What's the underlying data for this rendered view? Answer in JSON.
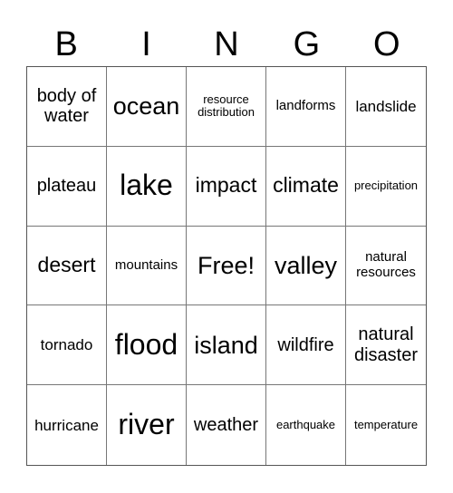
{
  "header": [
    "B",
    "I",
    "N",
    "G",
    "O"
  ],
  "cells": [
    [
      "body of water",
      "ocean",
      "resource distribution",
      "landforms",
      "landslide"
    ],
    [
      "plateau",
      "lake",
      "impact",
      "climate",
      "precipitation"
    ],
    [
      "desert",
      "mountains",
      "Free!",
      "valley",
      "natural resources"
    ],
    [
      "tornado",
      "flood",
      "island",
      "wildfire",
      "natural disaster"
    ],
    [
      "hurricane",
      "river",
      "weather",
      "earthquake",
      "temperature"
    ]
  ]
}
